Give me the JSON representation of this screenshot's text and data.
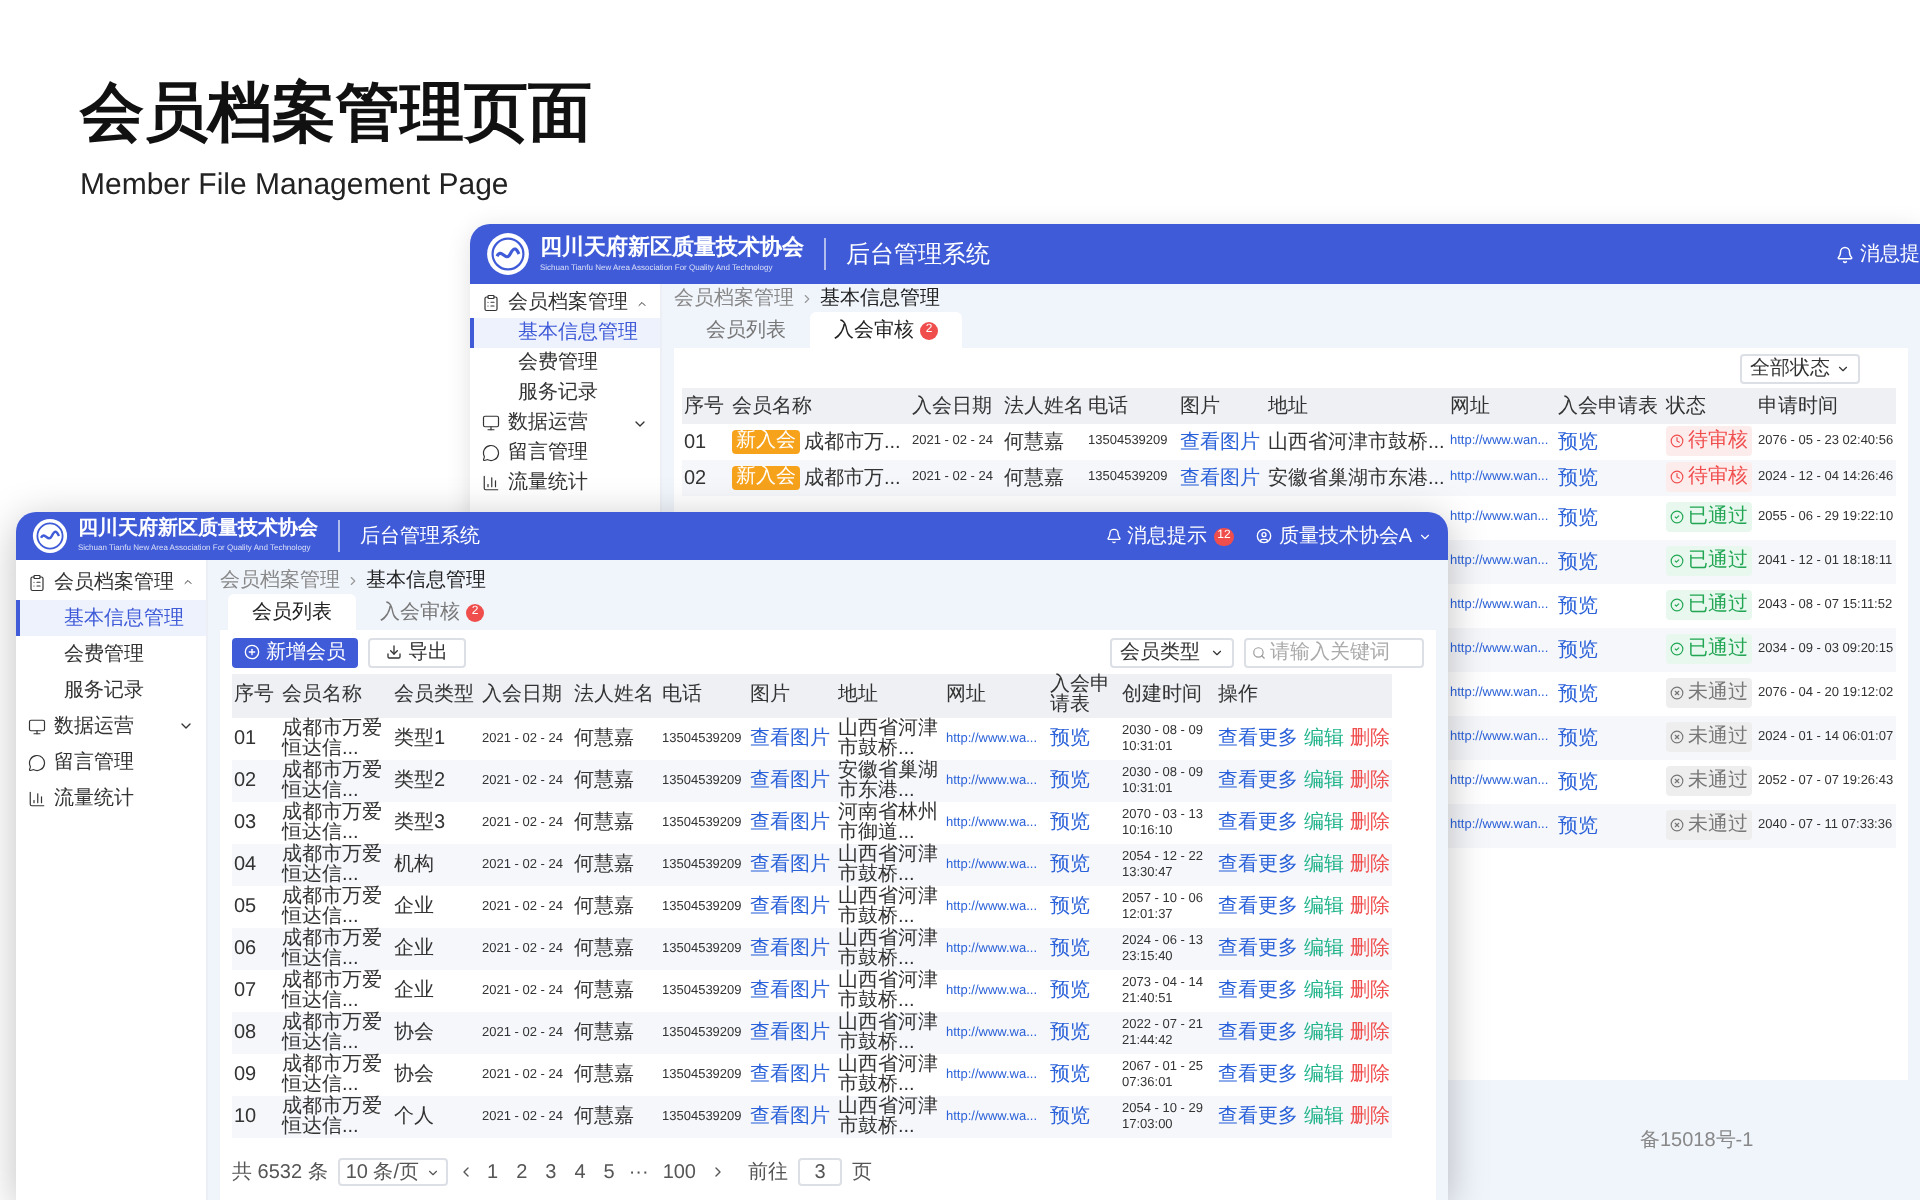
{
  "heading": {
    "title": "会员档案管理页面",
    "subtitle": "Member File Management Page"
  },
  "back_window": {
    "header": {
      "org_name": "四川天府新区质量技术协会",
      "org_subtitle": "Sichuan Tianfu New Area Association For Quality And Technology",
      "system_name": "后台管理系统",
      "notice": "消息提"
    },
    "sidebar": [
      {
        "label": "会员档案管理",
        "expanded": true,
        "children": [
          {
            "label": "基本信息管理",
            "selected": true
          },
          {
            "label": "会费管理",
            "selected": false
          },
          {
            "label": "服务记录",
            "selected": false
          }
        ]
      },
      {
        "label": "数据运营",
        "expanded": false
      },
      {
        "label": "留言管理"
      },
      {
        "label": "流量统计"
      }
    ],
    "breadcrumb": [
      "会员档案管理",
      "基本信息管理"
    ],
    "tabs": [
      {
        "label": "会员列表",
        "selected": false
      },
      {
        "label": "入会审核",
        "selected": true,
        "badge": "2"
      }
    ],
    "status_filter": "全部状态",
    "table": {
      "columns": [
        "序号",
        "会员名称",
        "入会日期",
        "法人姓名",
        "电话",
        "图片",
        "地址",
        "网址",
        "入会申请表",
        "状态",
        "申请时间"
      ],
      "rows": [
        {
          "no": "01",
          "tag": "新入会",
          "name": "成都市万...",
          "date": "2021 - 02 - 24",
          "legal_person": "何慧嘉",
          "phone": "13504539209",
          "picture": "查看图片",
          "address": "山西省河津市鼓桥...",
          "url": "http://www.wan...",
          "form": "预览",
          "status": {
            "kind": "pending",
            "label": "待审核"
          },
          "time": "2076 - 05 - 23 02:40:56"
        },
        {
          "no": "02",
          "tag": "新入会",
          "name": "成都市万...",
          "date": "2021 - 02 - 24",
          "legal_person": "何慧嘉",
          "phone": "13504539209",
          "picture": "查看图片",
          "address": "安徽省巢湖市东港...",
          "url": "http://www.wan...",
          "form": "预览",
          "status": {
            "kind": "pending",
            "label": "待审核"
          },
          "time": "2024 - 12 - 04 14:26:46"
        },
        {
          "url": "http://www.wan...",
          "form": "预览",
          "status": {
            "kind": "approved",
            "label": "已通过"
          },
          "time": "2055 - 06 - 29 19:22:10"
        },
        {
          "url": "http://www.wan...",
          "form": "预览",
          "status": {
            "kind": "approved",
            "label": "已通过"
          },
          "time": "2041 - 12 - 01 18:18:11"
        },
        {
          "url": "http://www.wan...",
          "form": "预览",
          "status": {
            "kind": "approved",
            "label": "已通过"
          },
          "time": "2043 - 08 - 07 15:11:52"
        },
        {
          "url": "http://www.wan...",
          "form": "预览",
          "status": {
            "kind": "approved",
            "label": "已通过"
          },
          "time": "2034 - 09 - 03 09:20:15"
        },
        {
          "url": "http://www.wan...",
          "form": "预览",
          "status": {
            "kind": "rejected",
            "label": "未通过"
          },
          "time": "2076 - 04 - 20 19:12:02"
        },
        {
          "url": "http://www.wan...",
          "form": "预览",
          "status": {
            "kind": "rejected",
            "label": "未通过"
          },
          "time": "2024 - 01 - 14 06:01:07"
        },
        {
          "url": "http://www.wan...",
          "form": "预览",
          "status": {
            "kind": "rejected",
            "label": "未通过"
          },
          "time": "2052 - 07 - 07 19:26:43"
        },
        {
          "url": "http://www.wan...",
          "form": "预览",
          "status": {
            "kind": "rejected",
            "label": "未通过"
          },
          "time": "2040 - 07 - 11 07:33:36"
        }
      ]
    },
    "footer": "备15018号-1"
  },
  "front_window": {
    "header": {
      "org_name": "四川天府新区质量技术协会",
      "org_subtitle": "Sichuan Tianfu New Area Association For Quality And Technology",
      "system_name": "后台管理系统",
      "notice": "消息提示",
      "notice_badge": "12",
      "user": "质量技术协会A"
    },
    "sidebar": [
      {
        "label": "会员档案管理",
        "expanded": true,
        "children": [
          {
            "label": "基本信息管理",
            "selected": true
          },
          {
            "label": "会费管理",
            "selected": false
          },
          {
            "label": "服务记录",
            "selected": false
          }
        ]
      },
      {
        "label": "数据运营",
        "expanded": false
      },
      {
        "label": "留言管理"
      },
      {
        "label": "流量统计"
      }
    ],
    "breadcrumb": [
      "会员档案管理",
      "基本信息管理"
    ],
    "tabs": [
      {
        "label": "会员列表",
        "selected": true
      },
      {
        "label": "入会审核",
        "selected": false,
        "badge": "2"
      }
    ],
    "toolbar": {
      "add_button": "新增会员",
      "export_button": "导出",
      "type_select": "会员类型",
      "search_placeholder": "请输入关键词"
    },
    "table": {
      "columns": [
        "序号",
        "会员名称",
        "会员类型",
        "入会日期",
        "法人姓名",
        "电话",
        "图片",
        "地址",
        "网址",
        "入会申请表",
        "创建时间",
        "操作"
      ],
      "rows": [
        {
          "no": "01",
          "name": "成都市万爱恒达信...",
          "type": "类型1",
          "date": "2021 - 02 - 24",
          "legal_person": "何慧嘉",
          "phone": "13504539209",
          "picture": "查看图片",
          "address": "山西省河津市鼓桥...",
          "url": "http://www.wa...",
          "form": "预览",
          "time": "2030 - 08 - 09 10:31:01",
          "actions": [
            {
              "kind": "view",
              "label": "查看更多"
            },
            {
              "kind": "edit",
              "label": "编辑"
            },
            {
              "kind": "delete",
              "label": "删除"
            }
          ]
        },
        {
          "no": "02",
          "name": "成都市万爱恒达信...",
          "type": "类型2",
          "date": "2021 - 02 - 24",
          "legal_person": "何慧嘉",
          "phone": "13504539209",
          "picture": "查看图片",
          "address": "安徽省巢湖市东港...",
          "url": "http://www.wa...",
          "form": "预览",
          "time": "2030 - 08 - 09 10:31:01",
          "actions": [
            {
              "kind": "view",
              "label": "查看更多"
            },
            {
              "kind": "edit",
              "label": "编辑"
            },
            {
              "kind": "delete",
              "label": "删除"
            }
          ]
        },
        {
          "no": "03",
          "name": "成都市万爱恒达信...",
          "type": "类型3",
          "date": "2021 - 02 - 24",
          "legal_person": "何慧嘉",
          "phone": "13504539209",
          "picture": "查看图片",
          "address": "河南省林州市御道...",
          "url": "http://www.wa...",
          "form": "预览",
          "time": "2070 - 03 - 13 10:16:10",
          "actions": [
            {
              "kind": "view",
              "label": "查看更多"
            },
            {
              "kind": "edit",
              "label": "编辑"
            },
            {
              "kind": "delete",
              "label": "删除"
            }
          ]
        },
        {
          "no": "04",
          "name": "成都市万爱恒达信...",
          "type": "机构",
          "date": "2021 - 02 - 24",
          "legal_person": "何慧嘉",
          "phone": "13504539209",
          "picture": "查看图片",
          "address": "山西省河津市鼓桥...",
          "url": "http://www.wa...",
          "form": "预览",
          "time": "2054 - 12 - 22 13:30:47",
          "actions": [
            {
              "kind": "view",
              "label": "查看更多"
            },
            {
              "kind": "edit",
              "label": "编辑"
            },
            {
              "kind": "delete",
              "label": "删除"
            }
          ]
        },
        {
          "no": "05",
          "name": "成都市万爱恒达信...",
          "type": "企业",
          "date": "2021 - 02 - 24",
          "legal_person": "何慧嘉",
          "phone": "13504539209",
          "picture": "查看图片",
          "address": "山西省河津市鼓桥...",
          "url": "http://www.wa...",
          "form": "预览",
          "time": "2057 - 10 - 06 12:01:37",
          "actions": [
            {
              "kind": "view",
              "label": "查看更多"
            },
            {
              "kind": "edit",
              "label": "编辑"
            },
            {
              "kind": "delete",
              "label": "删除"
            }
          ]
        },
        {
          "no": "06",
          "name": "成都市万爱恒达信...",
          "type": "企业",
          "date": "2021 - 02 - 24",
          "legal_person": "何慧嘉",
          "phone": "13504539209",
          "picture": "查看图片",
          "address": "山西省河津市鼓桥...",
          "url": "http://www.wa...",
          "form": "预览",
          "time": "2024 - 06 - 13 23:15:40",
          "actions": [
            {
              "kind": "view",
              "label": "查看更多"
            },
            {
              "kind": "edit",
              "label": "编辑"
            },
            {
              "kind": "delete",
              "label": "删除"
            }
          ]
        },
        {
          "no": "07",
          "name": "成都市万爱恒达信...",
          "type": "企业",
          "date": "2021 - 02 - 24",
          "legal_person": "何慧嘉",
          "phone": "13504539209",
          "picture": "查看图片",
          "address": "山西省河津市鼓桥...",
          "url": "http://www.wa...",
          "form": "预览",
          "time": "2073 - 04 - 14 21:40:51",
          "actions": [
            {
              "kind": "view",
              "label": "查看更多"
            },
            {
              "kind": "edit",
              "label": "编辑"
            },
            {
              "kind": "delete",
              "label": "删除"
            }
          ]
        },
        {
          "no": "08",
          "name": "成都市万爱恒达信...",
          "type": "协会",
          "date": "2021 - 02 - 24",
          "legal_person": "何慧嘉",
          "phone": "13504539209",
          "picture": "查看图片",
          "address": "山西省河津市鼓桥...",
          "url": "http://www.wa...",
          "form": "预览",
          "time": "2022 - 07 - 21 21:44:42",
          "actions": [
            {
              "kind": "view",
              "label": "查看更多"
            },
            {
              "kind": "edit",
              "label": "编辑"
            },
            {
              "kind": "delete",
              "label": "删除"
            }
          ]
        },
        {
          "no": "09",
          "name": "成都市万爱恒达信...",
          "type": "协会",
          "date": "2021 - 02 - 24",
          "legal_person": "何慧嘉",
          "phone": "13504539209",
          "picture": "查看图片",
          "address": "山西省河津市鼓桥...",
          "url": "http://www.wa...",
          "form": "预览",
          "time": "2067 - 01 - 25 07:36:01",
          "actions": [
            {
              "kind": "view",
              "label": "查看更多"
            },
            {
              "kind": "edit",
              "label": "编辑"
            },
            {
              "kind": "delete",
              "label": "删除"
            }
          ]
        },
        {
          "no": "10",
          "name": "成都市万爱恒达信...",
          "type": "个人",
          "date": "2021 - 02 - 24",
          "legal_person": "何慧嘉",
          "phone": "13504539209",
          "picture": "查看图片",
          "address": "山西省河津市鼓桥...",
          "url": "http://www.wa...",
          "form": "预览",
          "time": "2054 - 10 - 29 17:03:00",
          "actions": [
            {
              "kind": "view",
              "label": "查看更多"
            },
            {
              "kind": "edit",
              "label": "编辑"
            },
            {
              "kind": "delete",
              "label": "删除"
            }
          ]
        }
      ]
    },
    "pagination": {
      "total": "共 6532 条",
      "page_size": "10 条/页",
      "pages": [
        {
          "label": "1",
          "selected": false
        },
        {
          "label": "2",
          "selected": false
        },
        {
          "label": "3",
          "selected": false
        },
        {
          "label": "4",
          "selected": false
        },
        {
          "label": "5",
          "selected": false
        },
        {
          "label": "100",
          "selected": false
        }
      ],
      "ellipsis": "···",
      "goto_label": "前往",
      "goto_value": "3",
      "goto_suffix": "页"
    }
  }
}
